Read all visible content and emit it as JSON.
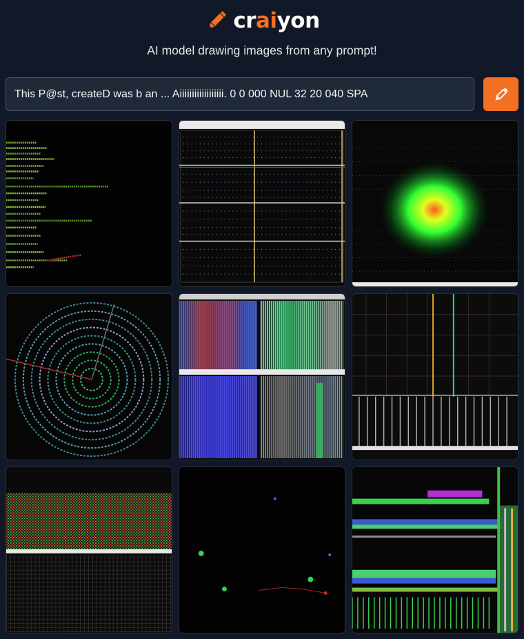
{
  "header": {
    "logo_prefix": "cr",
    "logo_accent": "ai",
    "logo_suffix": "yon",
    "tagline": "AI model drawing images from any prompt!"
  },
  "prompt": {
    "value": "This P@st, createD was b an ... Aiiiiiiiiiiiiiiiiii. 0 0 000 NUL 32 20 040 SPA"
  },
  "colors": {
    "background": "#111827",
    "accent": "#f36f21",
    "input_bg": "#1f2937"
  },
  "icons": {
    "logo": "pencil-icon",
    "draw_button": "pencil-icon"
  },
  "results": [
    {
      "name": "green text lines on black"
    },
    {
      "name": "grid of dotted panels"
    },
    {
      "name": "green glowing blob"
    },
    {
      "name": "circular dotted spiral"
    },
    {
      "name": "four multicolor striped panels"
    },
    {
      "name": "grid with vertical lines"
    },
    {
      "name": "dense colored dot grid"
    },
    {
      "name": "sparse glowing dots"
    },
    {
      "name": "horizontal neon streaks"
    }
  ]
}
